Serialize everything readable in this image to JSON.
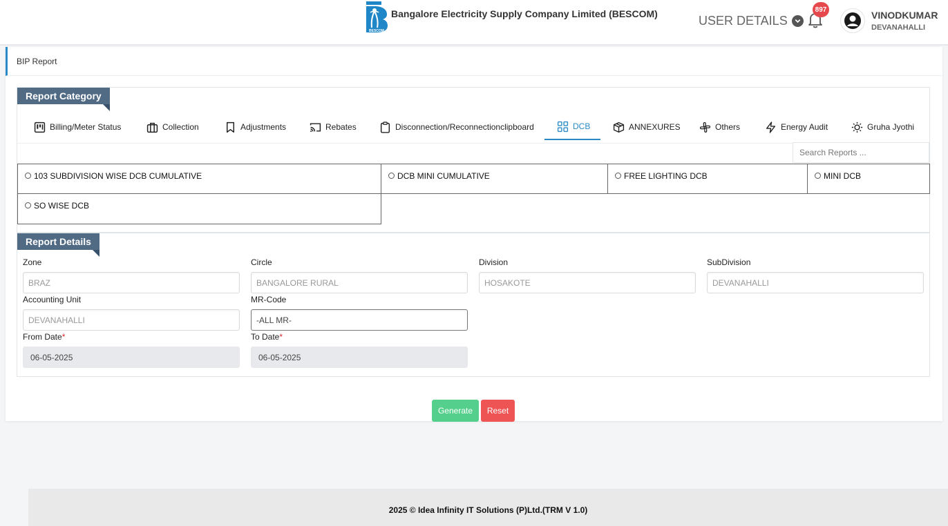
{
  "header": {
    "company_name": "Bangalore Electricity Supply Company Limited (BESCOM)",
    "logo_text": "BESCOM",
    "user_details_label": "USER DETAILS",
    "notification_count": "897",
    "user_name": "VINODKUMAR",
    "user_location": "DEVANAHALLI"
  },
  "breadcrumb": {
    "title": "BIP Report"
  },
  "report_category": {
    "heading": "Report Category",
    "tabs": [
      {
        "label": "Billing/Meter Status",
        "icon": "kanban-icon"
      },
      {
        "label": "Collection",
        "icon": "briefcase-icon"
      },
      {
        "label": "Adjustments",
        "icon": "bookmark-icon"
      },
      {
        "label": "Rebates",
        "icon": "cast-icon"
      },
      {
        "label": "Disconnection/Reconnectionclipboard",
        "icon": "clipboard-icon"
      },
      {
        "label": "DCB",
        "icon": "grid-icon",
        "active": true
      },
      {
        "label": "ANNEXURES",
        "icon": "box-icon"
      },
      {
        "label": "Others",
        "icon": "slack-icon"
      },
      {
        "label": "Energy Audit",
        "icon": "zap-icon"
      },
      {
        "label": "Gruha Jyothi",
        "icon": "sun-icon"
      }
    ],
    "search_placeholder": "Search Reports ...",
    "reports": [
      "103 SUBDIVISION WISE DCB CUMULATIVE",
      "DCB MINI CUMULATIVE",
      "FREE LIGHTING DCB",
      "MINI DCB",
      "SO WISE DCB"
    ]
  },
  "report_details": {
    "heading": "Report Details",
    "fields": {
      "zone": {
        "label": "Zone",
        "value": "BRAZ"
      },
      "circle": {
        "label": "Circle",
        "value": "BANGALORE RURAL"
      },
      "division": {
        "label": "Division",
        "value": "HOSAKOTE"
      },
      "subdivision": {
        "label": "SubDivision",
        "value": "DEVANAHALLI"
      },
      "accounting_unit": {
        "label": "Accounting Unit",
        "value": "DEVANAHALLI"
      },
      "mr_code": {
        "label": "MR-Code",
        "value": "-ALL MR-"
      },
      "from_date": {
        "label": "From Date",
        "value": "06-05-2025",
        "required_mark": "*"
      },
      "to_date": {
        "label": "To Date",
        "value": "06-05-2025",
        "required_mark": "*"
      }
    }
  },
  "actions": {
    "generate_label": "Generate",
    "reset_label": "Reset"
  },
  "footer": {
    "text": "2025 © Idea Infinity IT Solutions (P)Ltd.(TRM V 1.0)"
  },
  "colors": {
    "accent": "#2a8ac7",
    "ribbon": "#516b85",
    "generate": "#55d08c",
    "reset": "#ef5454",
    "badge": "#e5484d"
  }
}
